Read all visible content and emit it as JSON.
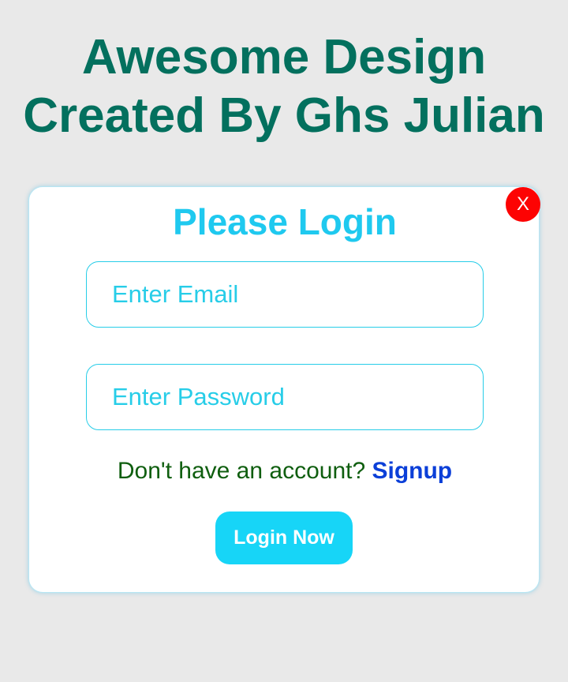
{
  "header": {
    "title_line1": "Awesome Design",
    "title_line2": "Created By Ghs Julian"
  },
  "login_card": {
    "close_label": "X",
    "title": "Please Login",
    "email_placeholder": "Enter Email",
    "email_value": "",
    "password_placeholder": "Enter Password",
    "password_value": "",
    "signup_prompt": "Don't have an account?",
    "signup_link": "Signup",
    "login_button": "Login Now"
  },
  "colors": {
    "background": "#e9e9e9",
    "title": "#03705e",
    "accent": "#1fc9ef",
    "close_button": "#fd0303",
    "signup_prompt": "#0f5e0f",
    "signup_link": "#0b3fd8",
    "login_button": "#17d5f7"
  }
}
